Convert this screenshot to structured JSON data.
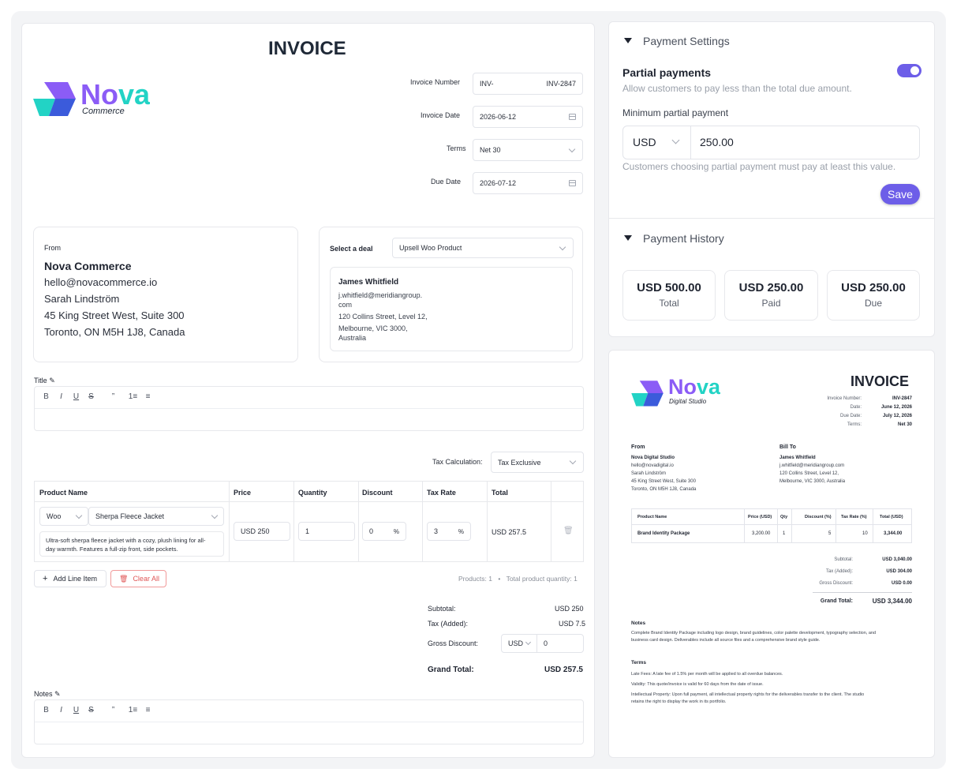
{
  "invoice": {
    "heading": "INVOICE",
    "logo": {
      "name": "Nova",
      "sub": "Commerce"
    },
    "fields": {
      "invoice_number_label": "Invoice Number",
      "invoice_number_prefix": "INV-",
      "invoice_number_value": "INV-2847",
      "invoice_date_label": "Invoice Date",
      "invoice_date_value": "2026-06-12",
      "terms_label": "Terms",
      "terms_value": "Net 30",
      "due_date_label": "Due Date",
      "due_date_value": "2026-07-12"
    },
    "from": {
      "label": "From",
      "company": "Nova Commerce",
      "email": "hello@novacommerce.io",
      "person": "Sarah Lindström",
      "address1": "45 King Street West, Suite 300",
      "address2": "Toronto, ON M5H 1J8, Canada"
    },
    "deal": {
      "label": "Select a deal",
      "value": "Upsell Woo Product",
      "contact_name": "James Whitfield",
      "contact_email_1": "j.whitfield@meridiangroup.",
      "contact_email_2": "com",
      "contact_addr1": "120 Collins Street, Level 12,",
      "contact_addr2": "Melbourne, VIC 3000,",
      "contact_addr3": "Australia"
    },
    "title_label": "Title",
    "notes_label": "Notes",
    "toolbar": {
      "bold": "B",
      "italic": "I",
      "underline": "U",
      "strike": "S",
      "quote": "”",
      "ol": "1≡",
      "ul": "≡"
    },
    "tax_calc_label": "Tax Calculation:",
    "tax_calc_value": "Tax Exclusive",
    "table": {
      "headers": [
        "Product Name",
        "Price",
        "Quantity",
        "Discount",
        "Tax Rate",
        "Total"
      ],
      "row": {
        "source": "Woo",
        "product": "Sherpa Fleece Jacket",
        "desc1": "Ultra-soft sherpa fleece jacket with a cozy, plush lining for all-",
        "desc2": "day warmth. Features a full-zip front, side pockets.",
        "price": "USD 250",
        "quantity": "1",
        "discount": "0",
        "discount_unit": "%",
        "tax": "3",
        "tax_unit": "%",
        "total": "USD 257.5"
      }
    },
    "add_line": "Add Line Item",
    "clear_all": "Clear All",
    "products_count": "Products: 1",
    "total_qty": "Total product quantity: 1",
    "totals": {
      "subtotal_label": "Subtotal:",
      "subtotal": "USD 250",
      "tax_label": "Tax (Added):",
      "tax": "USD 7.5",
      "gross_label": "Gross Discount:",
      "gross_currency": "USD",
      "gross_value": "0",
      "grand_label": "Grand Total:",
      "grand": "USD 257.5"
    }
  },
  "payment_settings": {
    "title": "Payment Settings",
    "partial_title": "Partial payments",
    "partial_desc": "Allow customers to pay less than the total due amount.",
    "min_label": "Minimum partial payment",
    "currency": "USD",
    "amount": "250.00",
    "hint": "Customers choosing partial payment must pay at least this value.",
    "save": "Save",
    "toggle_on": true
  },
  "payment_history": {
    "title": "Payment History",
    "cards": [
      {
        "amount": "USD 500.00",
        "label": "Total"
      },
      {
        "amount": "USD 250.00",
        "label": "Paid"
      },
      {
        "amount": "USD 250.00",
        "label": "Due"
      }
    ]
  },
  "preview": {
    "logo": {
      "name": "Nova",
      "sub": "Digital Studio"
    },
    "heading": "INVOICE",
    "meta": [
      {
        "k": "Invoice Number:",
        "v": "INV-2847"
      },
      {
        "k": "Date:",
        "v": "June 12, 2026"
      },
      {
        "k": "Due Date:",
        "v": "July 12, 2026"
      },
      {
        "k": "Terms:",
        "v": "Net 30"
      }
    ],
    "from_label": "From",
    "from_lines": [
      "Nova Digital Studio",
      "hello@novadigital.io",
      "Sarah Lindström",
      "45 King Street West, Suite 300",
      "Toronto, ON M5H 1J8, Canada"
    ],
    "bill_label": "Bill To",
    "bill_lines": [
      "James Whitfield",
      "j.whitfield@meridiangroup.com",
      "120 Collins Street, Level 12,",
      "Melbourne, VIC 3000, Australia"
    ],
    "table_headers": [
      "Product Name",
      "Price (USD)",
      "Qty",
      "Discount (%)",
      "Tax Rate (%)",
      "Total (USD)"
    ],
    "table_row": [
      "Brand Identity Package",
      "3,200.00",
      "1",
      "5",
      "10",
      "3,344.00"
    ],
    "totals": [
      {
        "k": "Subtotal:",
        "v": "USD 3,040.00"
      },
      {
        "k": "Tax (Added):",
        "v": "USD 304.00"
      },
      {
        "k": "Gross Discount:",
        "v": "USD 0.00"
      }
    ],
    "grand_label": "Grand Total:",
    "grand": "USD 3,344.00",
    "notes_label": "Notes",
    "notes_1": "Complete Brand Identity Package including logo design, brand guidelines, color palette development, typography selection, and",
    "notes_2": "business card design. Deliverables include all source files and a comprehensive brand style guide.",
    "terms_label": "Terms",
    "terms_1": "Late Fees: A late fee of 1.5% per month will be applied to all overdue balances.",
    "terms_2": "Validity: This quote/invoice is valid for 60 days from the date of issue.",
    "terms_3": "Intellectual Property: Upon full payment, all intellectual property rights for the deliverables transfer to the client. The studio",
    "terms_4": "retains the right to display the work in its portfolio."
  },
  "colors": {
    "accent": "#6d5ee8",
    "logo_purple": "#8b5cf6",
    "logo_teal": "#22d3c5",
    "logo_blue": "#3b5bdb"
  }
}
